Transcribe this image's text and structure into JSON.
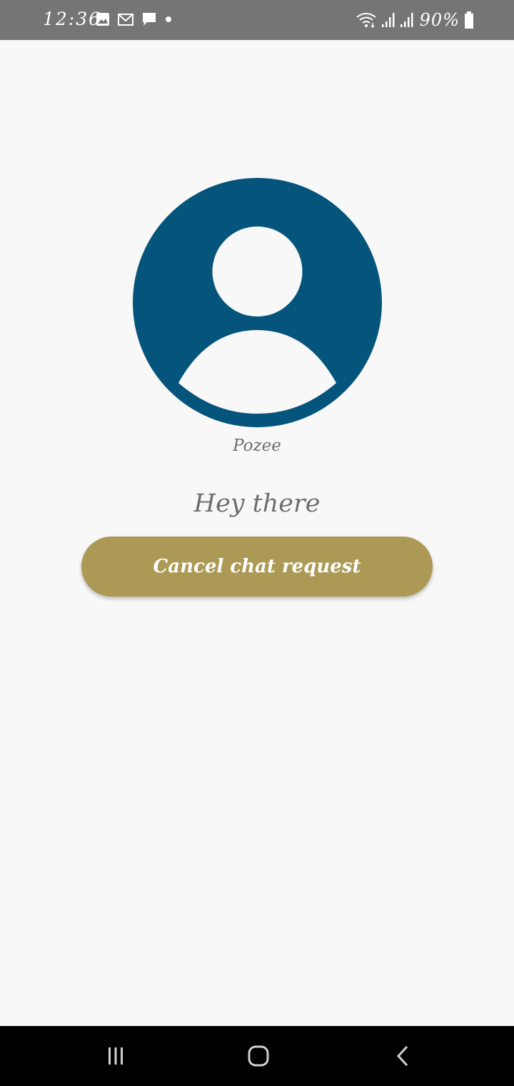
{
  "status_bar": {
    "time": "12:36",
    "battery_percent": "90%",
    "icons_left": [
      "image-icon",
      "gmail-icon",
      "message-icon",
      "dot-icon"
    ],
    "icons_right": [
      "wifi-icon",
      "signal-icon",
      "signal-icon",
      "battery-icon"
    ]
  },
  "profile": {
    "name": "Pozee",
    "status": "Hey there",
    "avatar_color": "#05547c"
  },
  "actions": {
    "cancel_label": "Cancel chat request",
    "button_color": "#ab9955"
  },
  "nav_bar": {
    "icons": [
      "recents-icon",
      "home-icon",
      "back-icon"
    ]
  }
}
